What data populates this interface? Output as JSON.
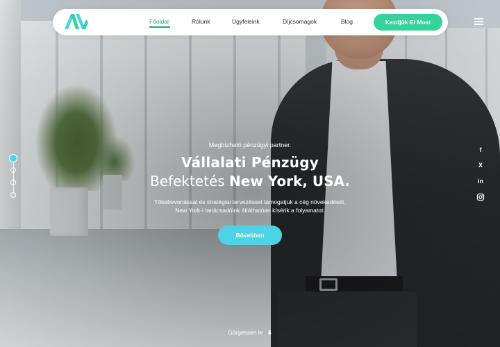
{
  "nav": {
    "items": [
      {
        "label": "Főoldal",
        "active": true
      },
      {
        "label": "Rólunk",
        "active": false
      },
      {
        "label": "Ügyfeleink",
        "active": false
      },
      {
        "label": "Díjcsomagok",
        "active": false
      },
      {
        "label": "Blog",
        "active": false
      }
    ],
    "cta_label": "Kezdjük El Most",
    "logo_icon": "brand-logo-icon",
    "menu_icon": "hamburger-menu-icon"
  },
  "hero": {
    "kicker": "Megbízható pénzügyi partner.",
    "title_line1": "Vállalati Pénzügy",
    "title_line2_regular": "Befektetés",
    "title_line2_bold": "New York, USA.",
    "description_line1": "Tőkebevonással és stratégiai tervezéssel támogatjuk a cég növekedését.",
    "description_line2": "New York-i tanácsadóink átláthatóan kísérik a folyamatot.",
    "button_label": "Bővebben",
    "scroll_hint": "Görgessen le",
    "scroll_icon": "arrow-down-icon"
  },
  "slider": {
    "dot_count": 4,
    "active_index": 0
  },
  "social": [
    "facebook-icon",
    "x-icon",
    "linkedin-icon",
    "instagram-icon"
  ],
  "colors": {
    "accent_green": "#34d39a",
    "accent_cyan": "#4ed3e5",
    "nav_active": "#1aa87a"
  }
}
